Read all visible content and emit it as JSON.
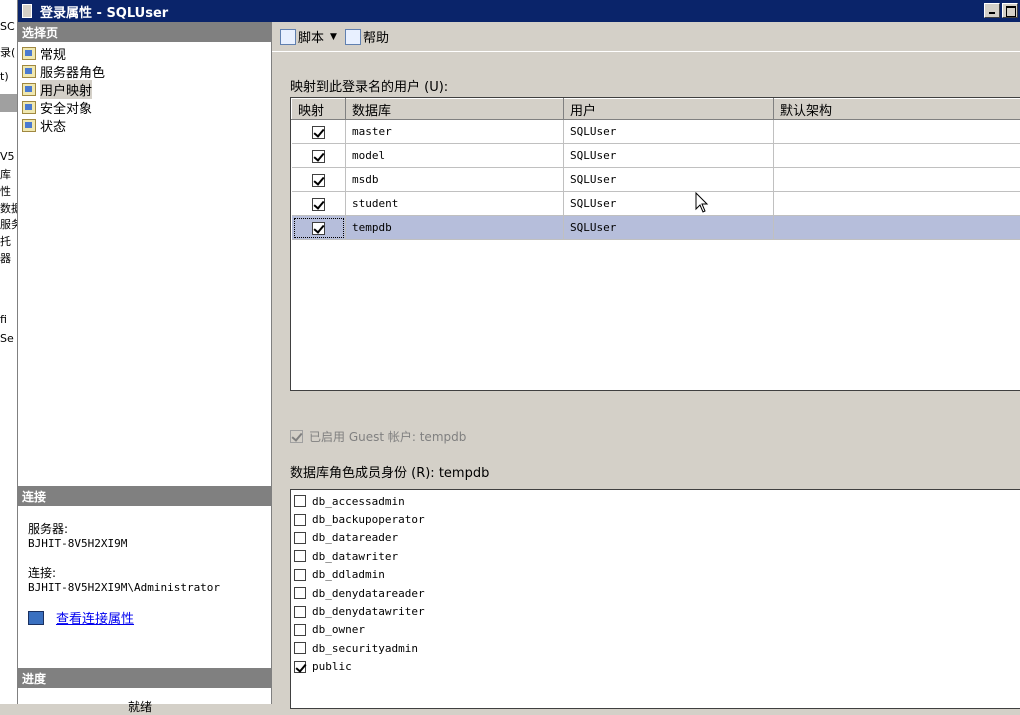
{
  "window": {
    "title": "登录属性 - SQLUser"
  },
  "background_fragments": [
    "SC",
    "录(",
    "t)",
    "V5",
    "库",
    "性",
    "数据",
    "服务",
    "托",
    "器",
    "fi",
    "Se"
  ],
  "left_panel": {
    "select_page_header": "选择页",
    "pages": [
      {
        "label": "常规",
        "icon": "page-icon"
      },
      {
        "label": "服务器角色",
        "icon": "page-icon"
      },
      {
        "label": "用户映射",
        "icon": "page-icon",
        "selected": true
      },
      {
        "label": "安全对象",
        "icon": "page-icon"
      },
      {
        "label": "状态",
        "icon": "page-icon"
      }
    ],
    "connection_header": "连接",
    "server_label": "服务器:",
    "server_value": "BJHIT-8V5H2XI9M",
    "connection_label": "连接:",
    "connection_value": "BJHIT-8V5H2XI9M\\Administrator",
    "view_connection_link": "查看连接属性",
    "progress_header": "进度",
    "progress_status": "就绪"
  },
  "toolbar": {
    "script_label": "脚本",
    "help_label": "帮助"
  },
  "mapping": {
    "label": "映射到此登录名的用户 (U):",
    "columns": [
      "映射",
      "数据库",
      "用户",
      "默认架构"
    ],
    "rows": [
      {
        "mapped": true,
        "database": "master",
        "user": "SQLUser",
        "schema": ""
      },
      {
        "mapped": true,
        "database": "model",
        "user": "SQLUser",
        "schema": ""
      },
      {
        "mapped": true,
        "database": "msdb",
        "user": "SQLUser",
        "schema": ""
      },
      {
        "mapped": true,
        "database": "student",
        "user": "SQLUser",
        "schema": ""
      },
      {
        "mapped": true,
        "database": "tempdb",
        "user": "SQLUser",
        "schema": "",
        "selected": true
      }
    ],
    "ellipsis": "..."
  },
  "guest": {
    "label": "已启用 Guest 帐户: tempdb",
    "checked": true
  },
  "roles": {
    "label": "数据库角色成员身份 (R): tempdb",
    "items": [
      {
        "name": "db_accessadmin",
        "checked": false
      },
      {
        "name": "db_backupoperator",
        "checked": false
      },
      {
        "name": "db_datareader",
        "checked": false
      },
      {
        "name": "db_datawriter",
        "checked": false
      },
      {
        "name": "db_ddladmin",
        "checked": false
      },
      {
        "name": "db_denydatareader",
        "checked": false
      },
      {
        "name": "db_denydatawriter",
        "checked": false
      },
      {
        "name": "db_owner",
        "checked": false
      },
      {
        "name": "db_securityadmin",
        "checked": false
      },
      {
        "name": "public",
        "checked": true
      }
    ]
  }
}
